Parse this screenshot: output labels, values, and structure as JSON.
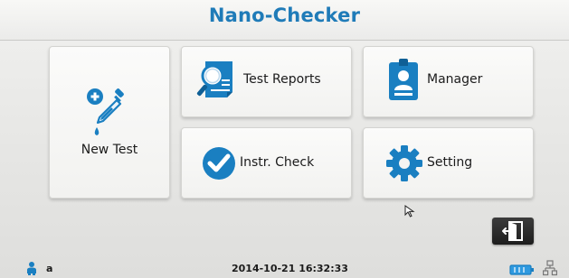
{
  "app": {
    "title": "Nano-Checker"
  },
  "menu": {
    "new_test_label": "New Test",
    "test_reports_label": "Test Reports",
    "manager_label": "Manager",
    "instr_check_label": "Instr. Check",
    "setting_label": "Setting"
  },
  "icons": {
    "new_test": "dropper-plus-icon",
    "test_reports": "magnifier-report-icon",
    "manager": "id-badge-icon",
    "instr_check": "checkmark-circle-icon",
    "setting": "gear-icon",
    "exit": "exit-door-icon",
    "user": "user-icon",
    "battery": "battery-icon",
    "network": "network-icon"
  },
  "status": {
    "user": "a",
    "datetime": "2014-10-21 16:32:33"
  },
  "colors": {
    "accent": "#1f7bb8",
    "icon_blue": "#1a7fc1",
    "exit_button": "#2a2a2a"
  }
}
